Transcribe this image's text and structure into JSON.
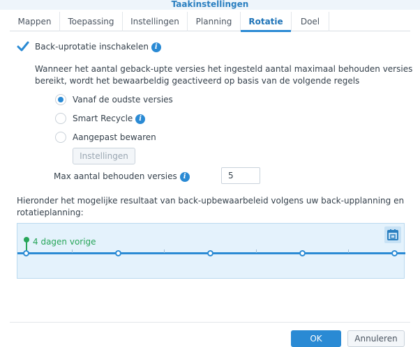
{
  "window": {
    "title": "Taakinstellingen"
  },
  "tabs": [
    {
      "label": "Mappen"
    },
    {
      "label": "Toepassing"
    },
    {
      "label": "Instellingen"
    },
    {
      "label": "Planning"
    },
    {
      "label": "Rotatie",
      "active": true
    },
    {
      "label": "Doel"
    }
  ],
  "rotation": {
    "enable_label": "Back-uprotatie inschakelen",
    "enabled": true,
    "description_line1": "Wanneer het aantal geback-upte versies het ingesteld aantal maximaal behouden versies",
    "description_line2": "bereikt, wordt het bewaarbeldig geactiveerd op basis van de volgende regels",
    "options": [
      {
        "label": "Vanaf de oudste versies",
        "selected": true
      },
      {
        "label": "Smart Recycle",
        "selected": false
      },
      {
        "label": "Aangepast bewaren",
        "selected": false
      }
    ],
    "settings_button": "Instellingen",
    "max_versions_label": "Max aantal behouden versies",
    "max_versions_value": "5"
  },
  "result": {
    "description_line1": "Hieronder het mogelijke resultaat van back-upbewaarbeleid volgens uw back-upplanning en",
    "description_line2": "rotatieplanning:",
    "marker_label": "4 dagen vorige"
  },
  "footer": {
    "ok_label": "OK",
    "cancel_label": "Annuleren"
  },
  "colors": {
    "accent": "#2a8ad4",
    "marker": "#27a559",
    "timeline_bg": "#e4f2fc"
  },
  "icons": {
    "info": "info-icon",
    "calendar": "calendar-icon",
    "check": "check-icon"
  }
}
